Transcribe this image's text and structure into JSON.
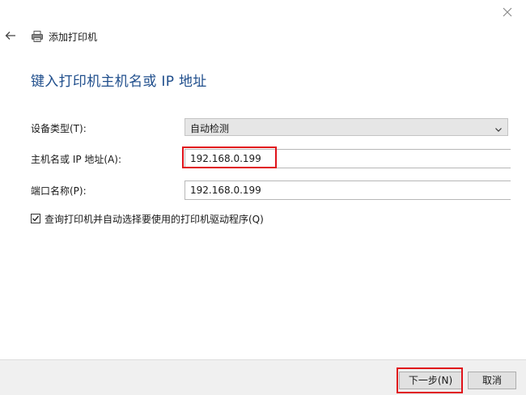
{
  "window": {
    "title": "添加打印机"
  },
  "page": {
    "heading": "键入打印机主机名或 IP 地址"
  },
  "form": {
    "device_type": {
      "label": "设备类型(T):",
      "value": "自动检测"
    },
    "hostname": {
      "label": "主机名或 IP 地址(A):",
      "value": "192.168.0.199"
    },
    "port_name": {
      "label": "端口名称(P):",
      "value": "192.168.0.199"
    },
    "query_driver": {
      "label": "查询打印机并自动选择要使用的打印机驱动程序(Q)",
      "checked": true
    }
  },
  "footer": {
    "next_label": "下一步(N)",
    "cancel_label": "取消"
  },
  "colors": {
    "heading": "#1f4e8c",
    "highlight": "#e0121a"
  },
  "icons": {
    "back": "back-arrow-icon",
    "printer": "printer-icon",
    "close": "close-icon",
    "dropdown": "chevron-down-icon",
    "check": "check-icon"
  }
}
